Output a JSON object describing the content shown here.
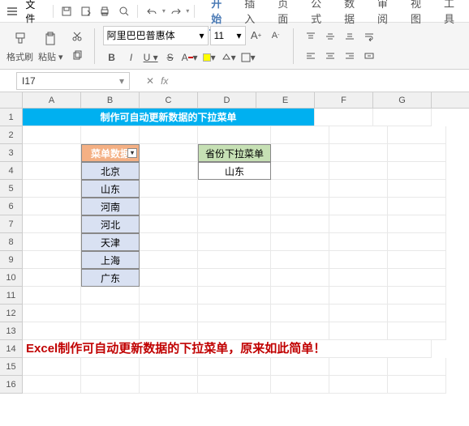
{
  "menubar": {
    "file": "文件"
  },
  "tabs": [
    "开始",
    "插入",
    "页面",
    "公式",
    "数据",
    "审阅",
    "视图",
    "工具"
  ],
  "active_tab_index": 0,
  "toolbar": {
    "format_painter": "格式刷",
    "paste": "粘贴",
    "font_name": "阿里巴巴普惠体",
    "font_size": "11"
  },
  "namebox": {
    "value": "I17"
  },
  "columns": [
    "A",
    "B",
    "C",
    "D",
    "E",
    "F",
    "G"
  ],
  "row_count": 16,
  "content": {
    "title": "制作可自动更新数据的下拉菜单",
    "menu_header": "菜单数据",
    "menu_items": [
      "北京",
      "山东",
      "河南",
      "河北",
      "天津",
      "上海",
      "广东"
    ],
    "dropdown_header": "省份下拉菜单",
    "dropdown_value": "山东",
    "footer_text": "Excel制作可自动更新数据的下拉菜单，原来如此简单！"
  }
}
